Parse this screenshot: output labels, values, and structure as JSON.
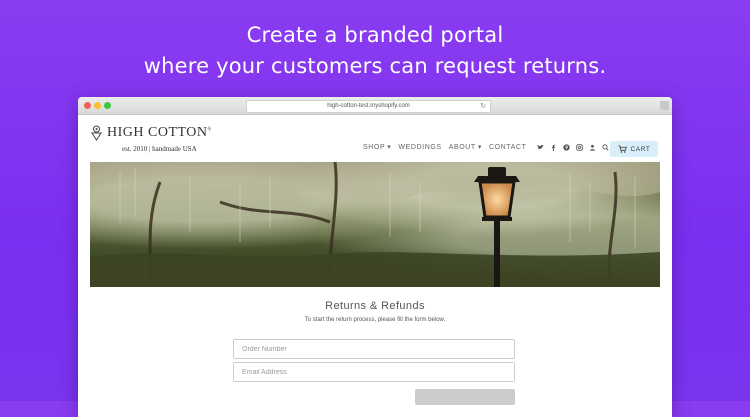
{
  "headline": {
    "line1": "Create a branded portal",
    "line2": "where your customers can request returns."
  },
  "browser": {
    "url": "high-cotton-test.myshopify.com"
  },
  "store": {
    "brand_name": "HIGH COTTON",
    "brand_trademark": "®",
    "brand_tagline": "est. 2010 | handmade USA",
    "nav": [
      "SHOP",
      "WEDDINGS",
      "ABOUT",
      "CONTACT"
    ],
    "social_icons": [
      "twitter-icon",
      "facebook-icon",
      "pinterest-icon",
      "instagram-icon",
      "account-icon",
      "search-icon"
    ],
    "cart_label": "CART"
  },
  "returns": {
    "title": "Returns & Refunds",
    "intro": "To start the return process, please fill the form below.",
    "order_placeholder": "Order Number",
    "email_placeholder": "Email Address"
  },
  "colors": {
    "background": "#7b2ff0",
    "cart_bg": "#d8eef8",
    "button_bg": "#cccccc"
  }
}
